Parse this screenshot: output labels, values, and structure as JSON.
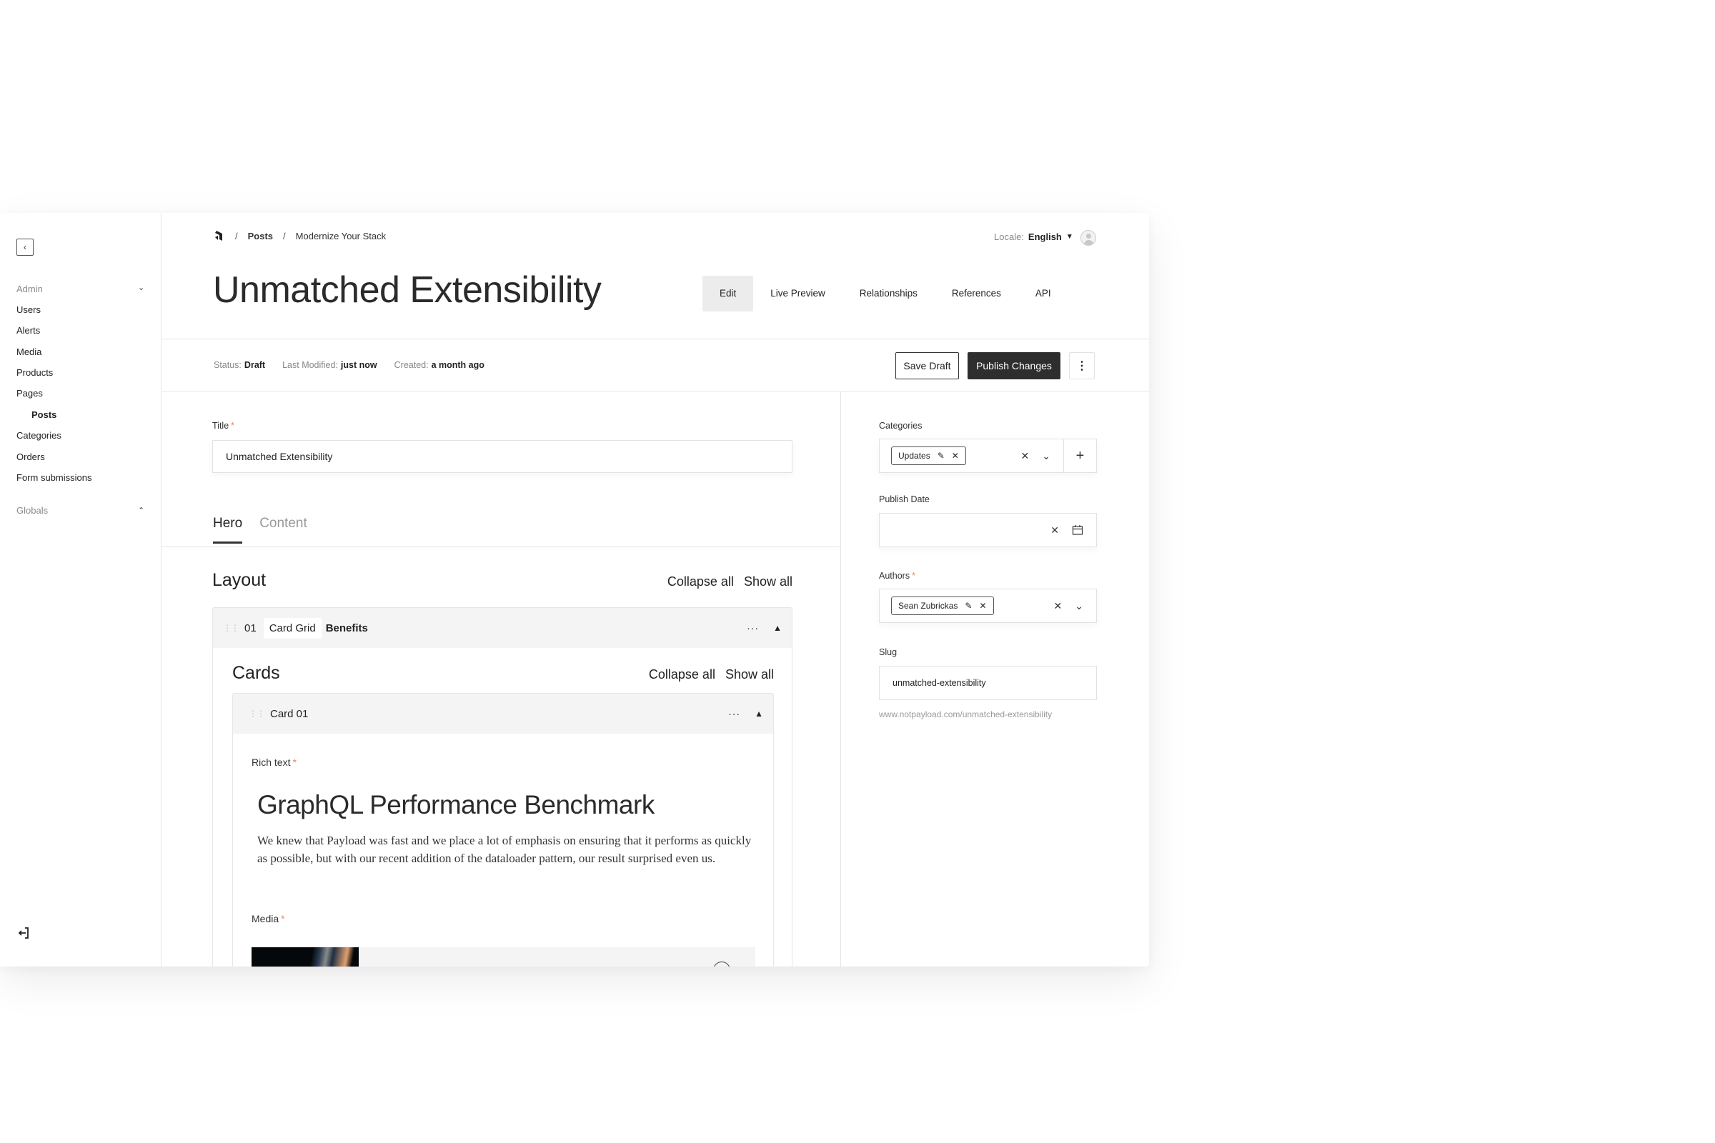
{
  "sidebar": {
    "collapse_icon": "chevron-left",
    "groups": [
      {
        "label": "Admin",
        "expanded": true
      },
      {
        "label": "Globals",
        "expanded": false
      }
    ],
    "items": [
      {
        "label": "Users"
      },
      {
        "label": "Alerts"
      },
      {
        "label": "Media"
      },
      {
        "label": "Products"
      },
      {
        "label": "Pages"
      },
      {
        "label": "Posts",
        "active": true
      },
      {
        "label": "Categories"
      },
      {
        "label": "Orders"
      },
      {
        "label": "Form submissions"
      }
    ],
    "logout_icon": "logout"
  },
  "header": {
    "breadcrumb": [
      "Posts",
      "Modernize Your Stack"
    ],
    "locale_label": "Locale:",
    "locale_value": "English",
    "title": "Unmatched Extensibility",
    "tabs": [
      {
        "label": "Edit",
        "active": true
      },
      {
        "label": "Live Preview"
      },
      {
        "label": "Relationships"
      },
      {
        "label": "References"
      },
      {
        "label": "API"
      }
    ]
  },
  "status_bar": {
    "status_label": "Status:",
    "status_value": "Draft",
    "modified_label": "Last Modified:",
    "modified_value": "just now",
    "created_label": "Created:",
    "created_value": "a month ago",
    "save_label": "Save Draft",
    "publish_label": "Publish Changes"
  },
  "form": {
    "title_label": "Title",
    "title_value": "Unmatched Extensibility",
    "tabs": [
      {
        "label": "Hero",
        "active": true
      },
      {
        "label": "Content"
      }
    ],
    "layout": {
      "heading": "Layout",
      "collapse_all": "Collapse all",
      "show_all": "Show all",
      "block": {
        "index": "01",
        "type": "Card Grid",
        "name": "Benefits"
      }
    },
    "cards": {
      "heading": "Cards",
      "collapse_all": "Collapse all",
      "show_all": "Show all",
      "card_label": "Card 01",
      "rich_text_label": "Rich text",
      "rich_text_heading": "GraphQL Performance Benchmark",
      "rich_text_body": "We knew that Payload was fast and we place a lot of emphasis on ensuring that it performs as quickly as possible, but with our recent addition of the dataloader pattern, our result surprised even us.",
      "media_label": "Media"
    }
  },
  "sidebar_fields": {
    "categories_label": "Categories",
    "categories": [
      "Updates"
    ],
    "publish_date_label": "Publish Date",
    "publish_date_value": "",
    "authors_label": "Authors",
    "authors": [
      "Sean Zubrickas"
    ],
    "slug_label": "Slug",
    "slug_value": "unmatched-extensibility",
    "slug_hint": "www.notpayload.com/unmatched-extensibility"
  },
  "colors": {
    "primary_button": "#2e2e2e",
    "required_asterisk": "#e8895a",
    "active_tab_bg": "#ececec"
  }
}
